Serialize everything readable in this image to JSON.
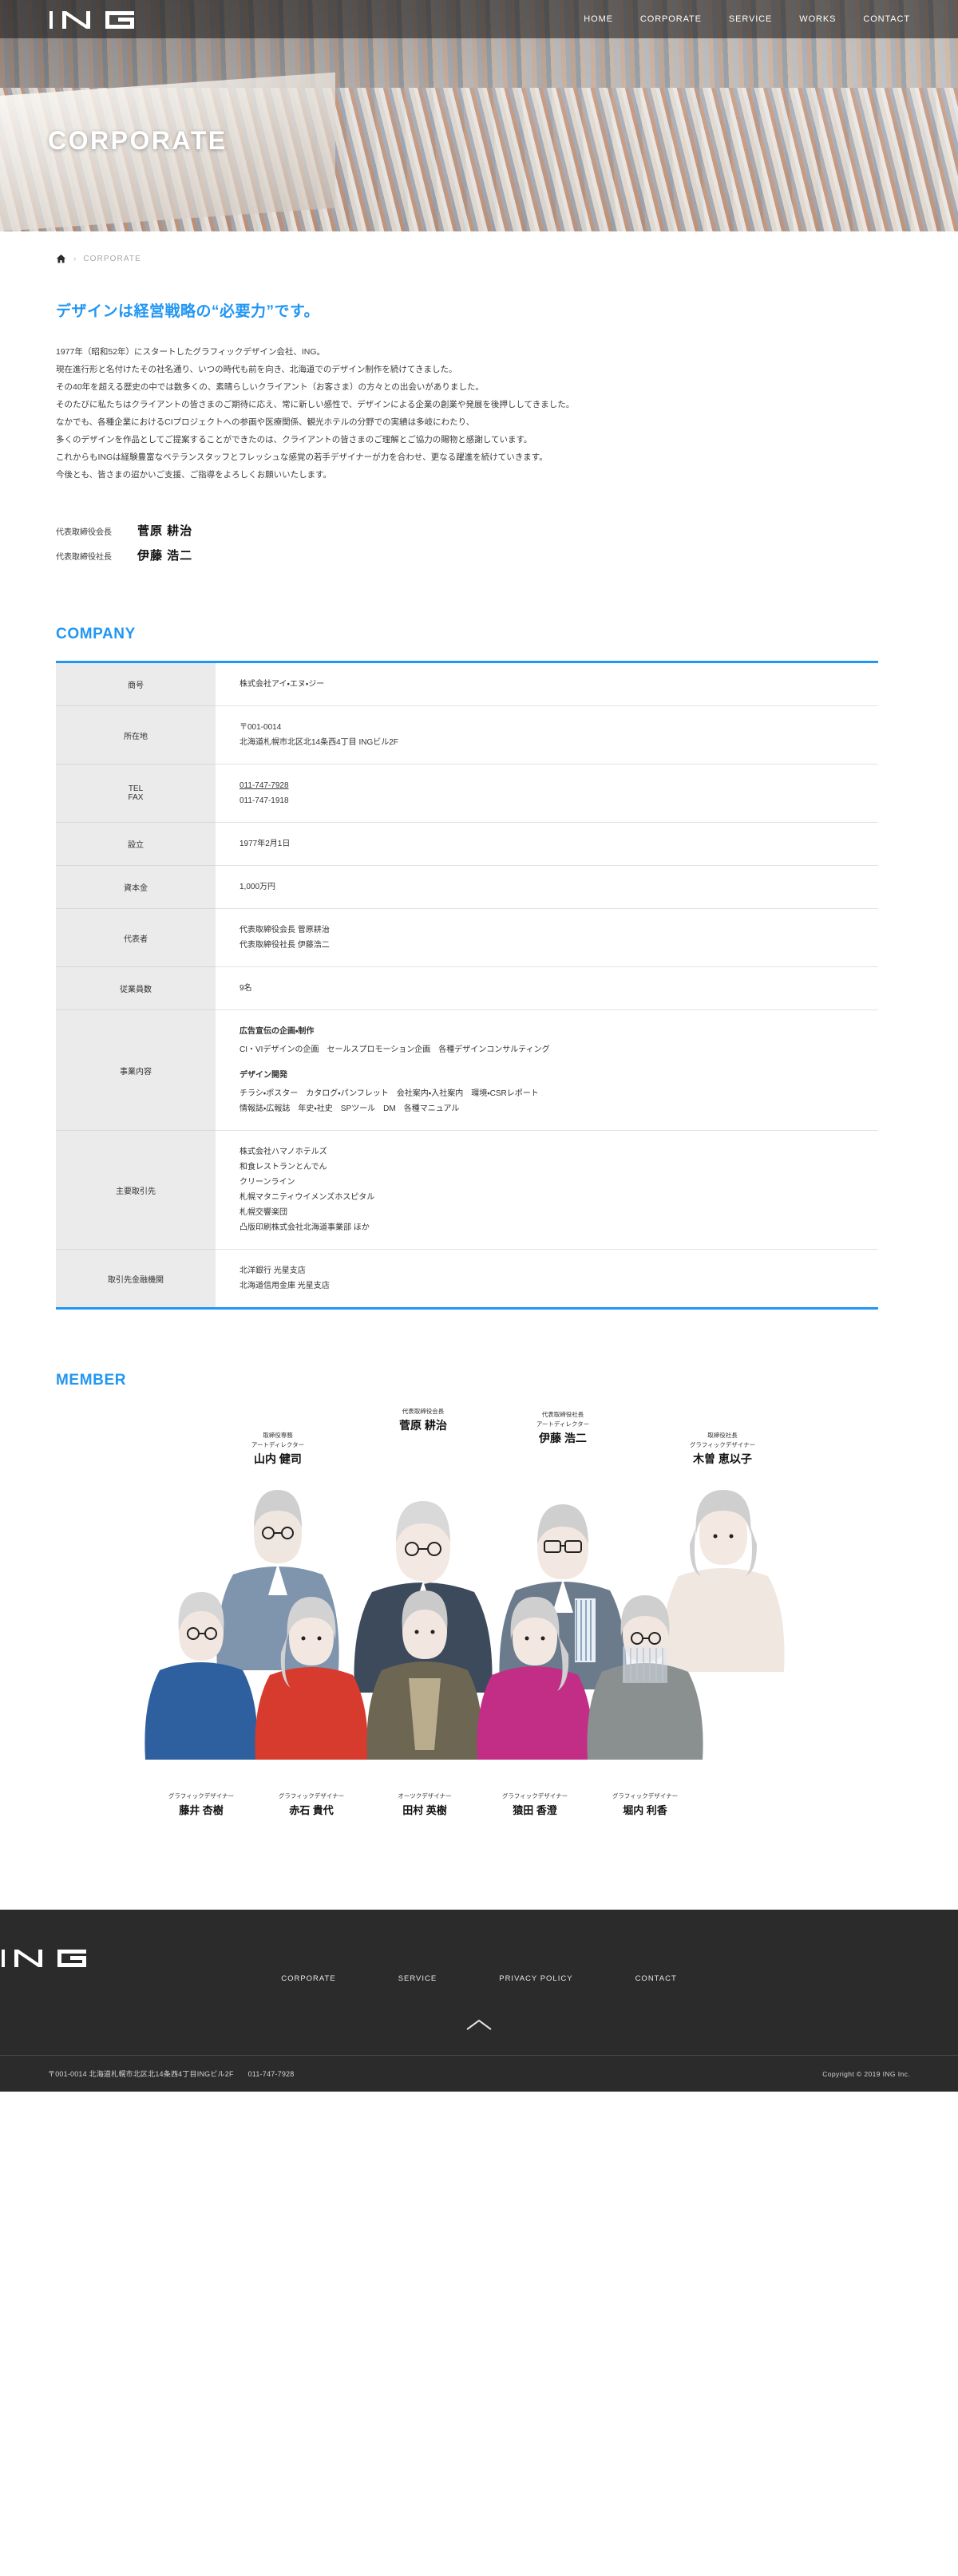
{
  "site": {
    "logo_text": "ING"
  },
  "nav": {
    "items": [
      {
        "label": "HOME"
      },
      {
        "label": "CORPORATE"
      },
      {
        "label": "SERVICE"
      },
      {
        "label": "WORKS"
      },
      {
        "label": "CONTACT"
      }
    ]
  },
  "hero": {
    "title": "CORPORATE"
  },
  "breadcrumb": {
    "home_icon": "home-icon",
    "separator": "›",
    "current": "CORPORATE"
  },
  "lead": {
    "title": "デザインは経営戦略の“必要力”です。",
    "paragraphs": [
      "1977年（昭和52年）にスタートしたグラフィックデザイン会社、ING。",
      "現在進行形と名付けたその社名通り、いつの時代も前を向き、北海道でのデザイン制作を続けてきました。",
      "その40年を超える歴史の中では数多くの、素晴らしいクライアント（お客さま）の方々との出会いがありました。",
      "そのたびに私たちはクライアントの皆さまのご期待に応え、常に新しい感性で、デザインによる企業の創業や発展を後押ししてきました。",
      "なかでも、各種企業におけるCIプロジェクトへの参画や医療関係、観光ホテルの分野での実績は多岐にわたり、",
      "多くのデザインを作品としてご提案することができたのは、クライアントの皆さまのご理解とご協力の賜物と感謝しています。",
      "これからもINGは経験豊富なベテランスタッフとフレッシュな感覚の若手デザイナーが力を合わせ、更なる躍進を続けていきます。",
      "今後とも、皆さまの迢かいご支援、ご指導をよろしくお願いいたします。"
    ]
  },
  "signatures": [
    {
      "role": "代表取締役会長",
      "name": "菅原 耕治"
    },
    {
      "role": "代表取締役社長",
      "name": "伊藤 浩二"
    }
  ],
  "company": {
    "heading": "COMPANY",
    "rows": [
      {
        "label": "商号",
        "lines": [
          "株式会社アイ・エヌ・ジー"
        ]
      },
      {
        "label": "所在地",
        "lines": [
          "〒001-0014",
          "北海道札幌市北区北14条西4丁目 INGビル2F"
        ]
      },
      {
        "label": "TEL\nFAX",
        "label_lines": [
          "TEL",
          "FAX"
        ],
        "lines": [
          "011-747-7928",
          "011-747-1918"
        ],
        "first_is_link": true
      },
      {
        "label": "設立",
        "lines": [
          "1977年2月1日"
        ]
      },
      {
        "label": "資本金",
        "lines": [
          "1,000万円"
        ]
      },
      {
        "label": "代表者",
        "lines": [
          "代表取締役会長 菅原耕治",
          "代表取締役社長 伊藤浩二"
        ]
      },
      {
        "label": "従業員数",
        "lines": [
          "9名"
        ]
      },
      {
        "label": "事業内容",
        "groups": [
          {
            "title": "広告宣伝の企画・制作",
            "lines": [
              "CI・VIデザインの企画　セールスプロモーション企画　各種デザインコンサルティング"
            ]
          },
          {
            "title": "デザイン開発",
            "lines": [
              "チラシ・ポスター　カタログ・パンフレット　会社案内・入社案内　環境・CSRレポート",
              "情報誌・広報誌　年史・社史　SPツール　DM　各種マニュアル"
            ]
          }
        ]
      },
      {
        "label": "主要取引先",
        "lines": [
          "株式会社ハマノホテルズ",
          "和食レストランとんでん",
          "クリーンライン",
          "札幌マタニティウイメンズホスピタル",
          "札幌交響楽団",
          "凸版印刷株式会社北海道事業部 ほか"
        ]
      },
      {
        "label": "取引先金融機関",
        "lines": [
          "北洋銀行 光星支店",
          "北海道信用金庫 光星支店"
        ]
      }
    ]
  },
  "member": {
    "heading": "MEMBER",
    "back_row": [
      {
        "role1": "取締役専務",
        "role2": "アートディレクター",
        "name": "山内 健司"
      },
      {
        "role1": "代表取締役会長",
        "role2": "",
        "name": "菅原 耕治"
      },
      {
        "role1": "代表取締役社長",
        "role2": "アートディレクター",
        "name": "伊藤 浩二"
      },
      {
        "role1": "取締役社長",
        "role2": "グラフィックデザイナー",
        "name": "木曽 恵以子"
      }
    ],
    "front_row": [
      {
        "role1": "グラフィックデザイナー",
        "name": "藤井 杏樹"
      },
      {
        "role1": "グラフィックデザイナー",
        "name": "赤石 貴代"
      },
      {
        "role1": "オーツクデザイナー",
        "name": "田村 英樹"
      },
      {
        "role1": "グラフィックデザイナー",
        "name": "猿田 香澄"
      },
      {
        "role1": "グラフィックデザイナー",
        "name": "堀内 利香"
      }
    ]
  },
  "footer": {
    "logo_text": "ING",
    "nav": [
      {
        "label": "CORPORATE"
      },
      {
        "label": "SERVICE"
      },
      {
        "label": "PRIVACY POLICY"
      },
      {
        "label": "CONTACT"
      }
    ],
    "to_top_icon": "chevron-up-icon",
    "address": "〒001-0014 北海道札幌市北区北14条西4丁目INGビル2F",
    "tel": "011-747-7928",
    "copyright": "Copyright ©  2019 ING Inc."
  },
  "colors": {
    "accent": "#2196f3",
    "footer_bg": "#2b2b2b",
    "table_head": "#ebebeb"
  }
}
